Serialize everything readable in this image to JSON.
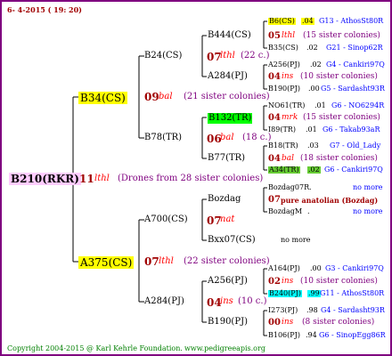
{
  "header": {
    "date": "6- 4-2015 ( 19: 20)"
  },
  "footer": {
    "copyright": "Copyright 2004-2015 @ Karl Kehrle Foundation.",
    "site": "www.pedigreeapis.org"
  },
  "root": {
    "id": "B210(RKR)",
    "year": "11",
    "breeder": "lthl",
    "note": "(Drones from 28 sister colonies)"
  },
  "gen1": [
    {
      "id": "B34(CS)",
      "year": "09",
      "breeder": "bal",
      "note": "(21 sister colonies)"
    },
    {
      "id": "A375(CS)",
      "year": "07",
      "breeder": "lthl",
      "note": "(22 sister colonies)"
    }
  ],
  "gen2": [
    {
      "id": "B24(CS)",
      "year": "07",
      "breeder": "lthl",
      "note": "(22 c.)"
    },
    {
      "id": "B78(TR)",
      "year": "06",
      "breeder": "bal",
      "note": "(18 c.)"
    },
    {
      "id": "A700(CS)",
      "year": "07",
      "breeder": "nat",
      "note": ""
    },
    {
      "id": "A284(PJ)",
      "year": "04",
      "breeder": "ins",
      "note": "(10 c.)"
    }
  ],
  "gen3": [
    {
      "id": "B444(CS)",
      "year": "05",
      "breeder": "lthl",
      "note": "(15 sister colonies)"
    },
    {
      "id": "A284(PJ)",
      "year": "04",
      "breeder": "ins",
      "note": "(10 sister colonies)"
    },
    {
      "id": "B132(TR)",
      "year": "04",
      "breeder": "mrk",
      "note": "(15 sister colonies)"
    },
    {
      "id": "B77(TR)",
      "year": "04",
      "breeder": "bal",
      "note": "(18 sister colonies)"
    },
    {
      "id": "Bozdag",
      "year": "07",
      "breeder": "pure anatolian (Bozdag)",
      "note": ""
    },
    {
      "id": "Bxx07(CS)",
      "year": "",
      "breeder": "",
      "note": "no more"
    },
    {
      "id": "A256(PJ)",
      "year": "02",
      "breeder": "ins",
      "note": "(10 sister colonies)"
    },
    {
      "id": "B190(PJ)",
      "year": "00",
      "breeder": "ins",
      "note": "(8 sister colonies)"
    }
  ],
  "gen4": [
    {
      "id": "B6(CS)",
      "num": ".04",
      "ref": "G13 - AthosSt80R"
    },
    {
      "id": "B35(CS)",
      "num": ".02",
      "ref": "G21 - Sinop62R"
    },
    {
      "id": "A256(PJ)",
      "num": ".02",
      "ref": "G4 - Cankiri97Q"
    },
    {
      "id": "B190(PJ)",
      "num": ".00",
      "ref": "G5 - Sardasht93R"
    },
    {
      "id": "NO61(TR)",
      "num": ".01",
      "ref": "G6 - NO6294R"
    },
    {
      "id": "I89(TR)",
      "num": ".01",
      "ref": "G6 - Takab93aR"
    },
    {
      "id": "B18(TR)",
      "num": ".03",
      "ref": "G7 - Old_Lady"
    },
    {
      "id": "A34(TR)",
      "num": ".02",
      "ref": "G6 - Cankiri97Q"
    },
    {
      "id": "Bozdag07R",
      "num": ".",
      "ref": "no more"
    },
    {
      "id": "BozdagM",
      "num": ".",
      "ref": "no more"
    },
    {
      "id": "A164(PJ)",
      "num": ".00",
      "ref": "G3 - Cankiri97Q"
    },
    {
      "id": "B240(PJ)",
      "num": ".99",
      "ref": "G11 - AthosSt80R"
    },
    {
      "id": "I273(PJ)",
      "num": ".98",
      "ref": "G4 - Sardasht93R"
    },
    {
      "id": "B106(PJ)",
      "num": ".94",
      "ref": "G6 - SinopEgg86R"
    }
  ]
}
